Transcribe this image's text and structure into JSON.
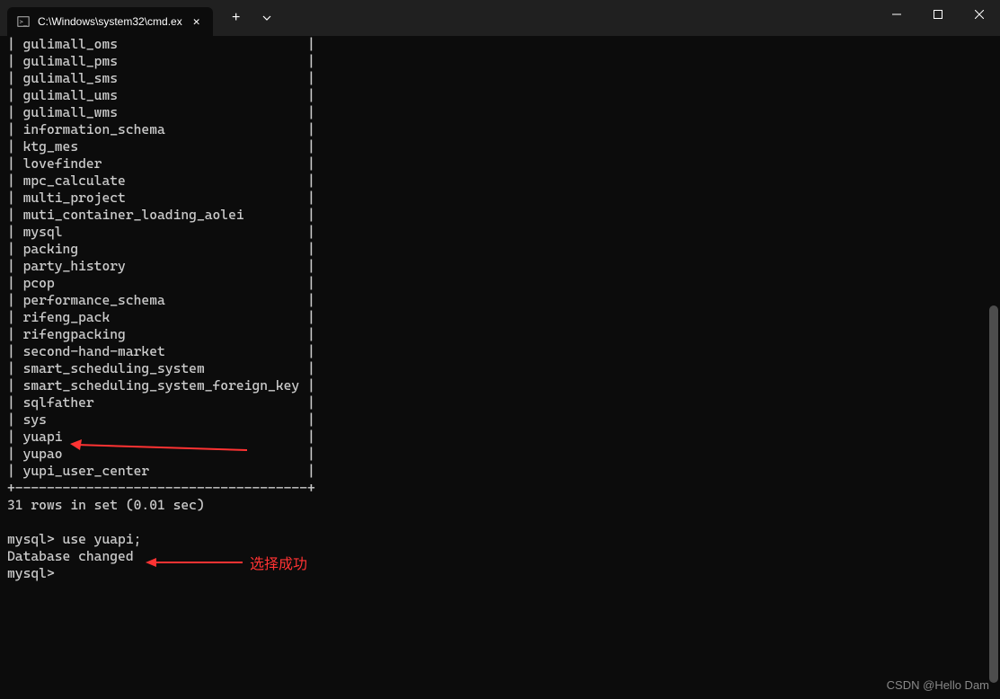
{
  "titlebar": {
    "tab_title": "C:\\Windows\\system32\\cmd.ex"
  },
  "terminal": {
    "databases": [
      "gulimall_oms",
      "gulimall_pms",
      "gulimall_sms",
      "gulimall_ums",
      "gulimall_wms",
      "information_schema",
      "ktg_mes",
      "lovefinder",
      "mpc_calculate",
      "multi_project",
      "muti_container_loading_aolei",
      "mysql",
      "packing",
      "party_history",
      "pcop",
      "performance_schema",
      "rifeng_pack",
      "rifengpacking",
      "second-hand-market",
      "smart_scheduling_system",
      "smart_scheduling_system_foreign_key",
      "sqlfather",
      "sys",
      "yuapi",
      "yupao",
      "yupi_user_center"
    ],
    "separator": "+-------------------------------------+",
    "result_text": "31 rows in set (0.01 sec)",
    "command1": "mysql> use yuapi;",
    "response1": "Database changed",
    "prompt": "mysql>"
  },
  "annotations": {
    "label1": "选择成功"
  },
  "watermark": "CSDN @Hello Dam"
}
